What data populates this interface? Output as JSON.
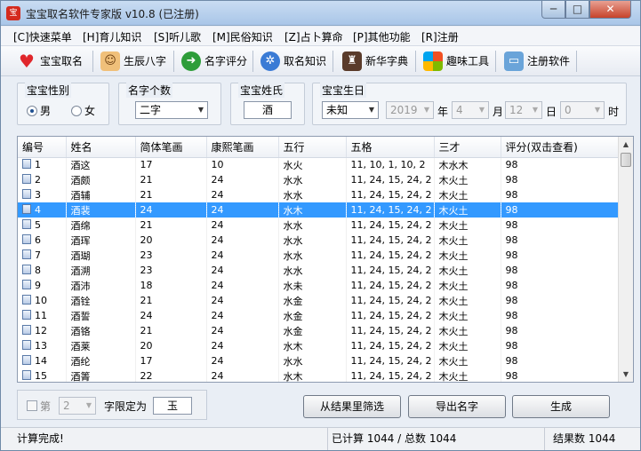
{
  "title": "宝宝取名软件专家版 v10.8 (已注册)",
  "window_controls": {
    "minimize": "─",
    "maximize": "□",
    "close": "✕"
  },
  "menu": [
    "[C]快速菜单",
    "[H]育儿知识",
    "[S]听儿歌",
    "[M]民俗知识",
    "[Z]占卜算命",
    "[P]其他功能",
    "[R]注册"
  ],
  "toolbar": [
    {
      "label": "宝宝取名",
      "icon": "heart-icon"
    },
    {
      "label": "生辰八字",
      "icon": "people-icon"
    },
    {
      "label": "名字评分",
      "icon": "arrow-right-icon"
    },
    {
      "label": "取名知识",
      "icon": "sparkle-icon"
    },
    {
      "label": "新华字典",
      "icon": "graduate-icon"
    },
    {
      "label": "趣味工具",
      "icon": "windows-icon"
    },
    {
      "label": "注册软件",
      "icon": "monitor-icon"
    }
  ],
  "gender": {
    "label": "宝宝性别",
    "male": "男",
    "female": "女",
    "selected": "男"
  },
  "name_length": {
    "label": "名字个数",
    "value": "二字"
  },
  "surname": {
    "label": "宝宝姓氏",
    "value": "酒"
  },
  "birthday": {
    "label": "宝宝生日",
    "time": "未知",
    "year": "2019",
    "year_unit": "年",
    "month": "4",
    "month_unit": "月",
    "day": "12",
    "day_unit": "日",
    "hour": "0",
    "hour_unit": "时"
  },
  "table": {
    "columns": [
      "编号",
      "姓名",
      "简体笔画",
      "康熙笔画",
      "五行",
      "五格",
      "三才",
      "评分(双击查看)"
    ],
    "selected_index": 3,
    "rows": [
      [
        "1",
        "酒这",
        "17",
        "10",
        "水火",
        "11, 10, 1, 10, 2",
        "木水木",
        "98"
      ],
      [
        "2",
        "酒颇",
        "21",
        "24",
        "水水",
        "11, 24, 15, 24, 2",
        "木火土",
        "98"
      ],
      [
        "3",
        "酒辅",
        "21",
        "24",
        "水水",
        "11, 24, 15, 24, 2",
        "木火土",
        "98"
      ],
      [
        "4",
        "酒裴",
        "24",
        "24",
        "水木",
        "11, 24, 15, 24, 2",
        "木火土",
        "98"
      ],
      [
        "5",
        "酒绵",
        "21",
        "24",
        "水水",
        "11, 24, 15, 24, 2",
        "木火土",
        "98"
      ],
      [
        "6",
        "酒珲",
        "20",
        "24",
        "水水",
        "11, 24, 15, 24, 2",
        "木火土",
        "98"
      ],
      [
        "7",
        "酒瑚",
        "23",
        "24",
        "水水",
        "11, 24, 15, 24, 2",
        "木火土",
        "98"
      ],
      [
        "8",
        "酒溯",
        "23",
        "24",
        "水水",
        "11, 24, 15, 24, 2",
        "木火土",
        "98"
      ],
      [
        "9",
        "酒沛",
        "18",
        "24",
        "水未",
        "11, 24, 15, 24, 2",
        "木火土",
        "98"
      ],
      [
        "10",
        "酒铨",
        "21",
        "24",
        "水金",
        "11, 24, 15, 24, 2",
        "木火土",
        "98"
      ],
      [
        "11",
        "酒誓",
        "24",
        "24",
        "水金",
        "11, 24, 15, 24, 2",
        "木火土",
        "98"
      ],
      [
        "12",
        "酒铬",
        "21",
        "24",
        "水金",
        "11, 24, 15, 24, 2",
        "木火土",
        "98"
      ],
      [
        "13",
        "酒莱",
        "20",
        "24",
        "水木",
        "11, 24, 15, 24, 2",
        "木火土",
        "98"
      ],
      [
        "14",
        "酒纶",
        "17",
        "24",
        "水水",
        "11, 24, 15, 24, 2",
        "木火土",
        "98"
      ],
      [
        "15",
        "酒箐",
        "22",
        "24",
        "水木",
        "11, 24, 15, 24, 2",
        "木火土",
        "98"
      ]
    ]
  },
  "filter": {
    "check_label": "第",
    "position": "2",
    "limit_label": "字限定为",
    "limit_value": "玉"
  },
  "buttons": {
    "filter_results": "从结果里筛选",
    "export": "导出名字",
    "generate": "生成"
  },
  "status": {
    "message": "计算完成!",
    "progress": "已计算 1044 / 总数 1044",
    "results": "结果数 1044"
  },
  "colors": {
    "selection": "#3399ff",
    "close_button": "#c7432b",
    "title_bar": "#a9c6e8"
  }
}
